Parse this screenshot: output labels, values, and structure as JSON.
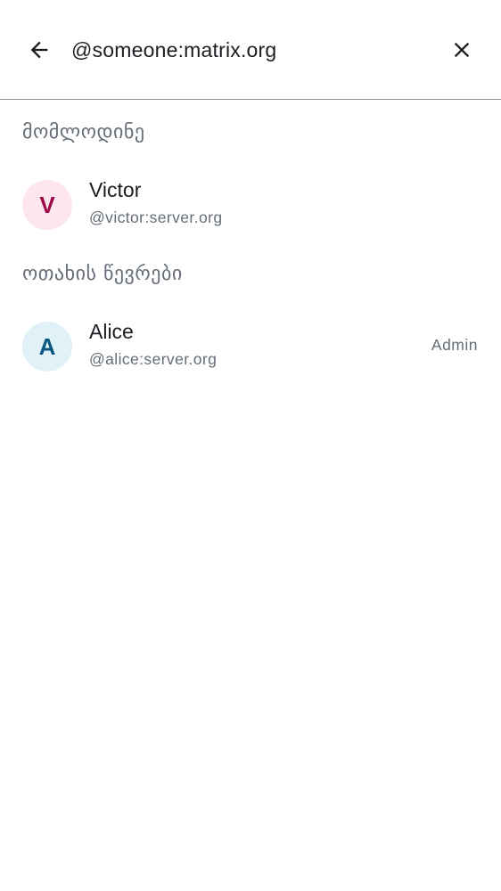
{
  "search": {
    "value": "@someone:matrix.org",
    "back_icon": "arrow-back-icon",
    "clear_icon": "close-icon"
  },
  "sections": {
    "pending": {
      "title": "მომლოდინე",
      "members": [
        {
          "initial": "V",
          "name": "Victor",
          "user_id": "@victor:server.org",
          "avatar_bg": "#fde6ee",
          "avatar_fg": "#9b0a4b"
        }
      ]
    },
    "room_members": {
      "title": "ოთახის წევრები",
      "members": [
        {
          "initial": "A",
          "name": "Alice",
          "user_id": "@alice:server.org",
          "role": "Admin",
          "avatar_bg": "#e0f2f8",
          "avatar_fg": "#0b5680"
        }
      ]
    }
  },
  "colors": {
    "divider": "#8e8f97",
    "secondary_text": "#656d77",
    "primary_text": "#1b1d22"
  }
}
